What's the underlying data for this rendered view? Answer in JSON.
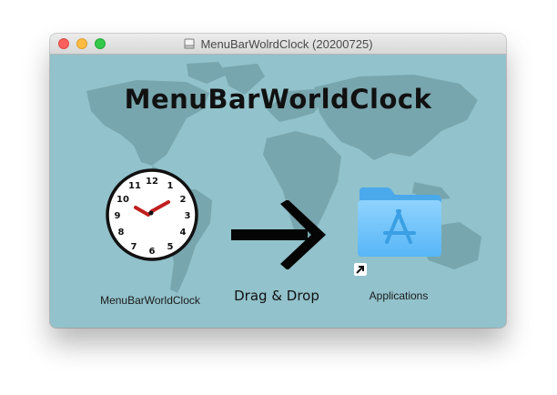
{
  "window": {
    "title": "MenuBarWolrdClock (20200725)",
    "background_color": "#92c2cb",
    "traffic_lights": [
      "close",
      "minimize",
      "zoom"
    ]
  },
  "content": {
    "heading": "MenuBarWorldClock",
    "app_item": {
      "label": "MenuBarWorldClock",
      "icon": "clock-icon"
    },
    "instruction": "Drag & Drop",
    "arrow_icon": "right-arrow-icon",
    "target_item": {
      "label": "Applications",
      "icon": "applications-folder-icon",
      "alias_badge": "alias-arrow-icon"
    },
    "clock_numbers": [
      "12",
      "1",
      "2",
      "3",
      "4",
      "5",
      "6",
      "7",
      "8",
      "9",
      "10",
      "11"
    ]
  }
}
